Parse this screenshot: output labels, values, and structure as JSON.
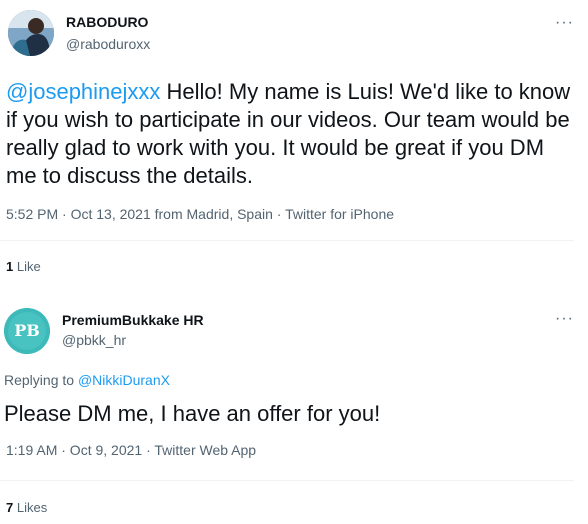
{
  "tweet1": {
    "display_name": "RABODURO",
    "handle": "@raboduroxx",
    "more_label": "···",
    "mention": "@josephinejxxx",
    "text": " Hello! My name is Luis! We'd like to know if you wish to participate in our videos. Our team would be really glad to work with you. It would be great if you DM me to discuss the details.",
    "meta": "5:52 PM · Oct 13, 2021 from Madrid, Spain · Twitter for iPhone",
    "likes_count": "1",
    "likes_label": "Like"
  },
  "tweet2": {
    "display_name": "PremiumBukkake HR",
    "handle": "@pbkk_hr",
    "more_label": "···",
    "avatar_text": "PB",
    "replying_prefix": "Replying to ",
    "replying_to": "@NikkiDuranX",
    "text": "Please DM me, I have an offer for you!",
    "meta": "1:19 AM · Oct 9, 2021 · Twitter Web App",
    "likes_count": "7",
    "likes_label": "Likes"
  },
  "colors": {
    "accent": "#1d9bf0",
    "secondary_text": "#536471",
    "divider": "#eff3f4"
  }
}
